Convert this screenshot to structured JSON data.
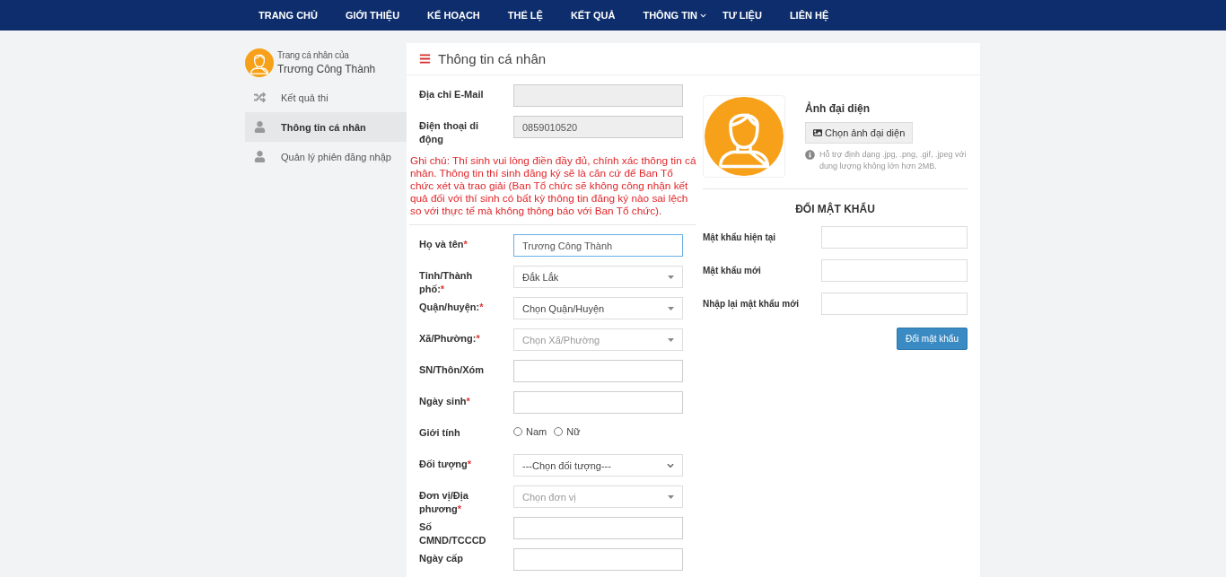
{
  "nav": {
    "items": [
      {
        "label": "TRANG CHỦ",
        "dropdown": false
      },
      {
        "label": "GIỚI THIỆU",
        "dropdown": false
      },
      {
        "label": "KẾ HOẠCH",
        "dropdown": false
      },
      {
        "label": "THỂ LỆ",
        "dropdown": false
      },
      {
        "label": "KẾT QUẢ",
        "dropdown": false
      },
      {
        "label": "THÔNG TIN",
        "dropdown": true
      },
      {
        "label": "TƯ LIỆU",
        "dropdown": false
      },
      {
        "label": "LIÊN HỆ",
        "dropdown": false
      }
    ]
  },
  "sidebar": {
    "caption": "Trang cá nhân của",
    "user_name": "Trương Công Thành",
    "items": [
      {
        "label": "Kết quả thi",
        "kind": "shuffle",
        "selected": false
      },
      {
        "label": "Thông tin cá nhân",
        "kind": "user",
        "selected": true
      },
      {
        "label": "Quản lý phiên đăng nhập",
        "kind": "user",
        "selected": false
      }
    ]
  },
  "panel": {
    "title": "Thông tin cá nhân",
    "contact_fields": [
      {
        "label": "Địa chỉ E-Mail",
        "kind": "text",
        "disabled": true
      },
      {
        "label": "Điện thoại di động",
        "kind": "text",
        "value": "0859010520",
        "disabled": true
      }
    ],
    "note": "Ghi chú: Thí sinh vui lòng điền đầy đủ, chính xác thông tin cá nhân. Thông tin thí sinh đăng ký sẽ là căn cứ để Ban Tổ chức xét và trao giải (Ban Tổ chức sẽ không công nhận kết quả đối với thí sinh có bất kỳ thông tin đăng ký nào sai lệch so với thực tế mà không thông báo với Ban Tổ chức).",
    "fields": [
      {
        "label": "Họ và tên",
        "mark": "*",
        "kind": "text",
        "value": "Trương Công Thành",
        "focused": true
      },
      {
        "label": "Tỉnh/Thành phố:",
        "mark": "*",
        "kind": "select",
        "value": "Đắk Lắk"
      },
      {
        "label": "Quận/huyện:",
        "mark": "*",
        "kind": "select",
        "value": "Chọn Quận/Huyện"
      },
      {
        "label": "Xã/Phường:",
        "mark": "*",
        "kind": "select",
        "placeholder": "Chọn Xã/Phường"
      },
      {
        "label": "SN/Thôn/Xóm",
        "kind": "text"
      },
      {
        "label": "Ngày sinh",
        "mark": "*",
        "kind": "text"
      },
      {
        "label": "Giới tính",
        "kind": "radio",
        "options": [
          {
            "label": "Nam",
            "selected": false
          },
          {
            "label": "Nữ",
            "selected": false
          }
        ]
      },
      {
        "label": "Đối tượng",
        "mark": "*",
        "kind": "native-select",
        "value": "---Chọn đối tượng---"
      },
      {
        "label": "Đơn vị/Địa phương",
        "mark": "*",
        "kind": "select",
        "placeholder": "Chọn đơn vị"
      },
      {
        "label": "Số CMND/TCCCD",
        "kind": "text"
      },
      {
        "label": "Ngày cấp",
        "kind": "text"
      }
    ]
  },
  "avatar": {
    "title": "Ảnh đại diện",
    "button": "Chọn ảnh đại diện",
    "hint": "Hỗ trợ định dạng .jpg, .png, .gif, .jpeg với dung lượng không lớn hơn 2MB."
  },
  "password": {
    "title": "ĐỔI MẬT KHẨU",
    "fields": [
      {
        "label": "Mật khẩu hiện tại"
      },
      {
        "label": "Mật khẩu mới"
      },
      {
        "label": "Nhập lại mật khẩu mới"
      }
    ],
    "button": "Đổi mật khẩu"
  }
}
